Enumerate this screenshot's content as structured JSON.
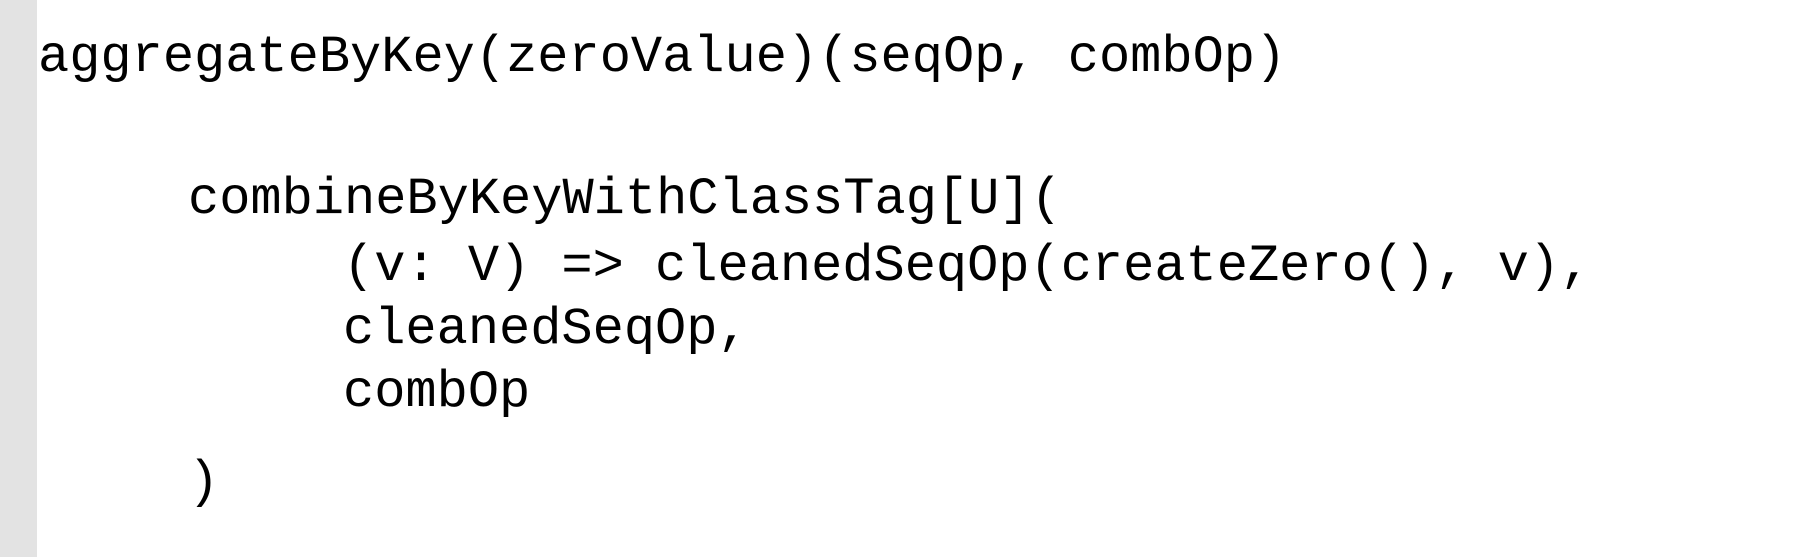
{
  "code": {
    "lines": [
      "aggregateByKey(zeroValue)(seqOp, combOp)",
      "combineByKeyWithClassTag[U](",
      "(v: V) => cleanedSeqOp(createZero(), v),",
      "cleanedSeqOp,",
      "combOp",
      ")"
    ]
  },
  "colors": {
    "gutter": "#e3e3e3",
    "background": "#ffffff",
    "text": "#000000"
  }
}
